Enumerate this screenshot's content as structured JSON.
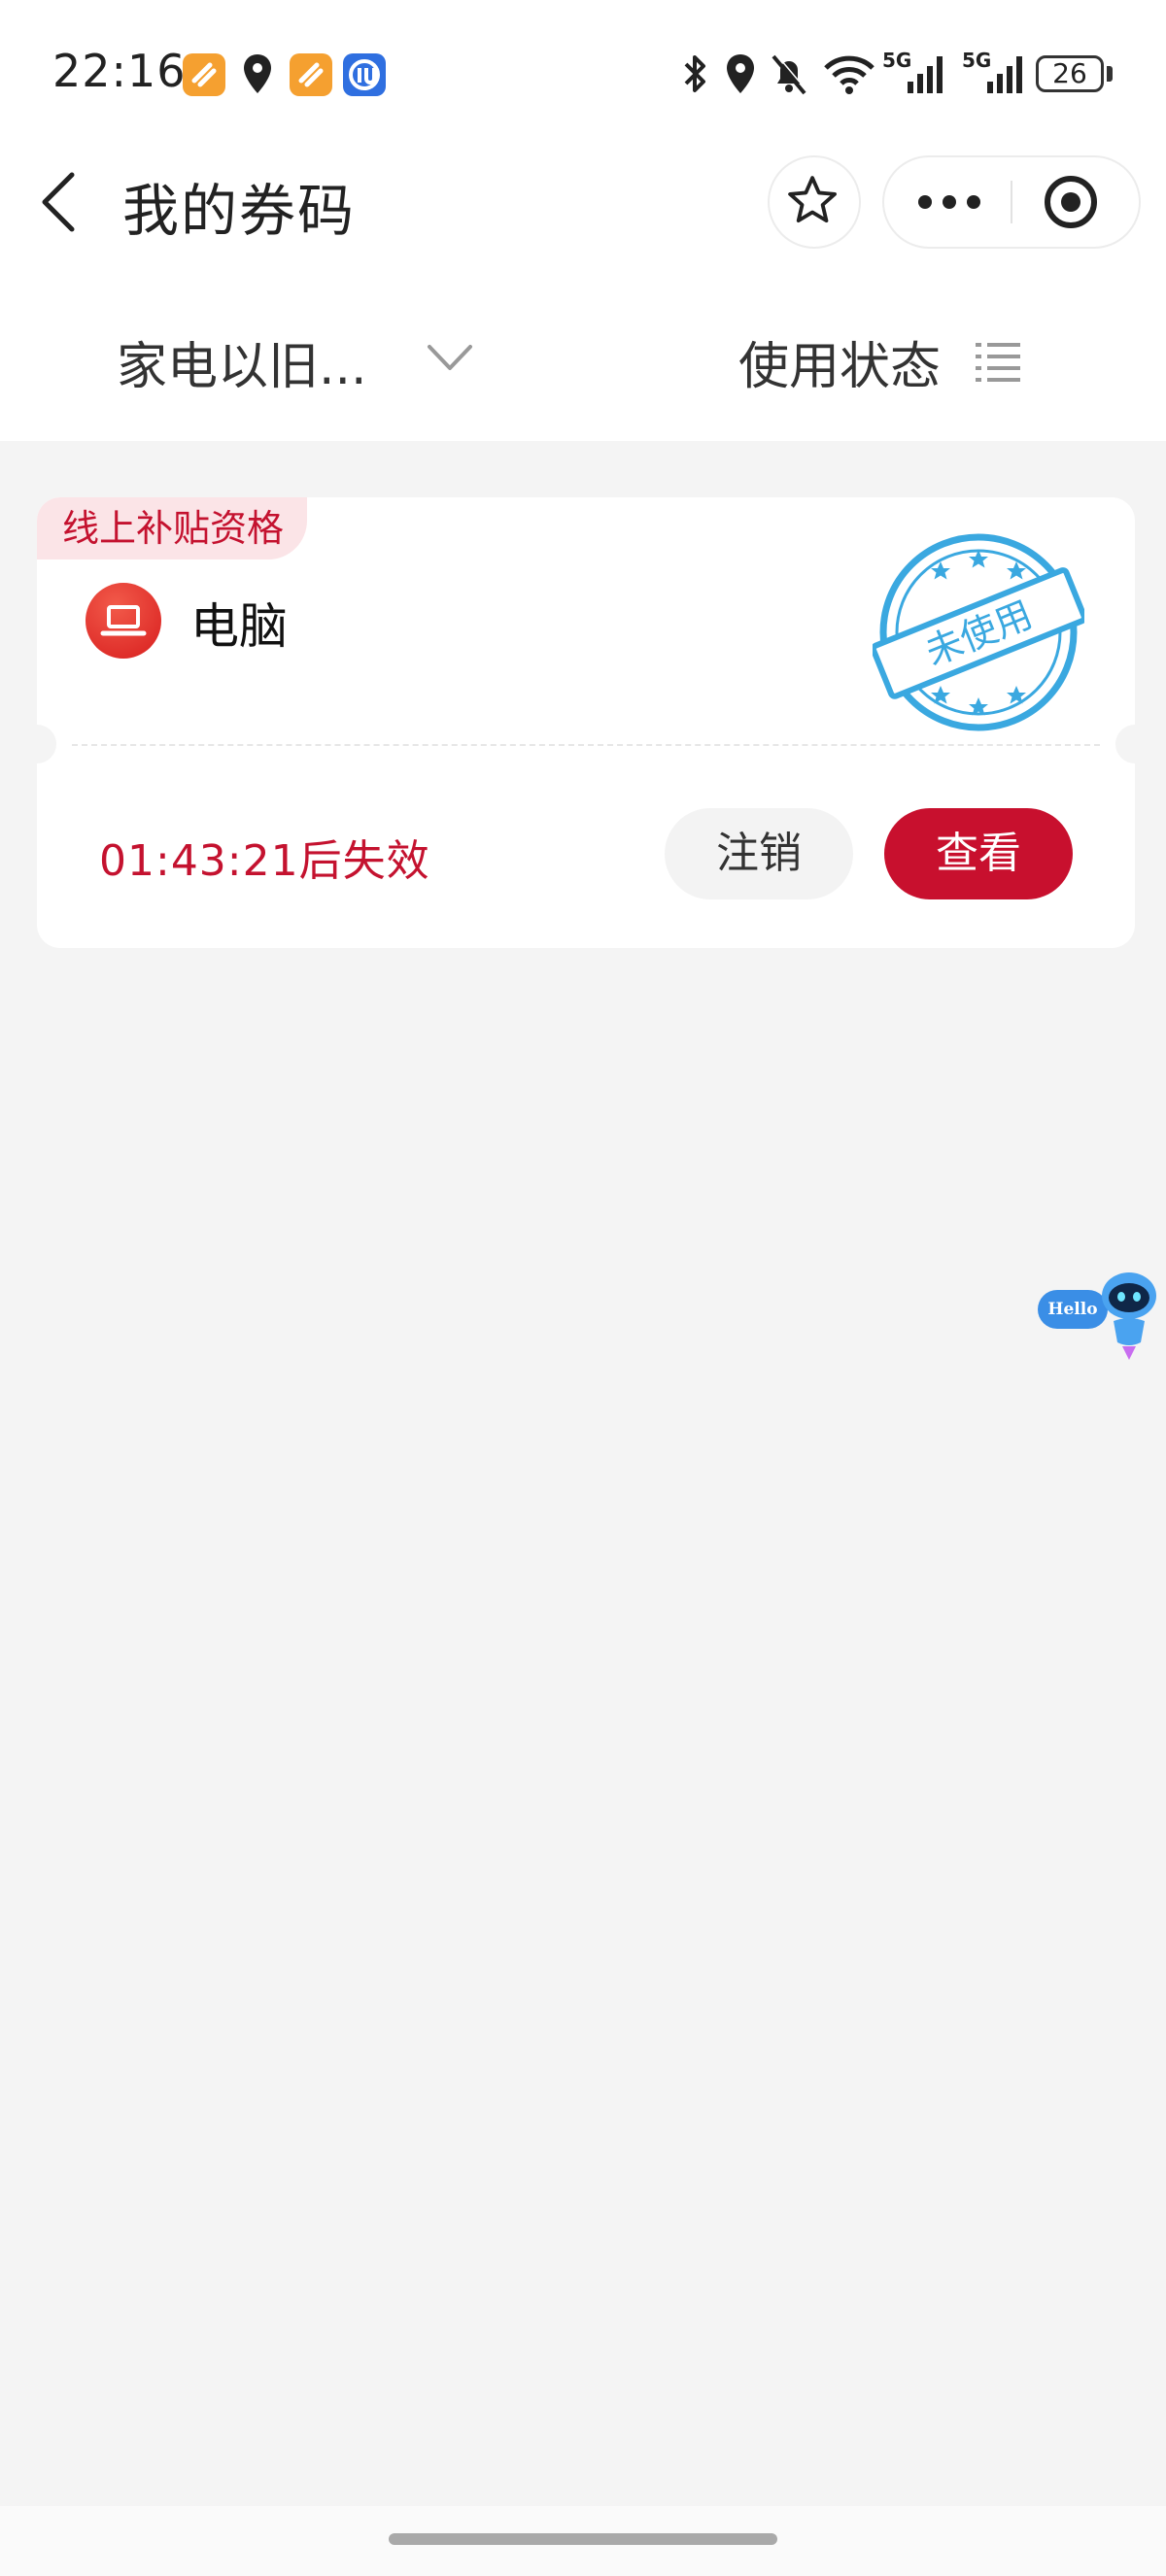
{
  "status_bar": {
    "time": "22:16",
    "battery": "26",
    "network_1": "5G",
    "network_2": "5G",
    "icons": [
      "app-orange-icon",
      "location-icon",
      "app-orange-icon",
      "app-blue-icon",
      "bluetooth-icon",
      "location-icon",
      "bell-muted-icon",
      "wifi-icon",
      "signal-icon",
      "signal-icon",
      "battery-icon"
    ]
  },
  "nav": {
    "title": "我的券码",
    "icons": [
      "back-arrow-icon",
      "star-icon",
      "more-dots-icon",
      "target-icon"
    ]
  },
  "filters": {
    "left_label": "家电以旧...",
    "right_label": "使用状态"
  },
  "coupon": {
    "tag": "线上补贴资格",
    "category": "电脑",
    "stamp_text": "未使用",
    "countdown": "01:43:21后失效",
    "cancel_label": "注销",
    "view_label": "查看"
  },
  "assistant": {
    "bubble": "Hello"
  },
  "colors": {
    "accent": "#c8102e",
    "tag_bg": "#fbe4e7",
    "stamp": "#3aa8e0",
    "background": "#f4f4f4"
  }
}
